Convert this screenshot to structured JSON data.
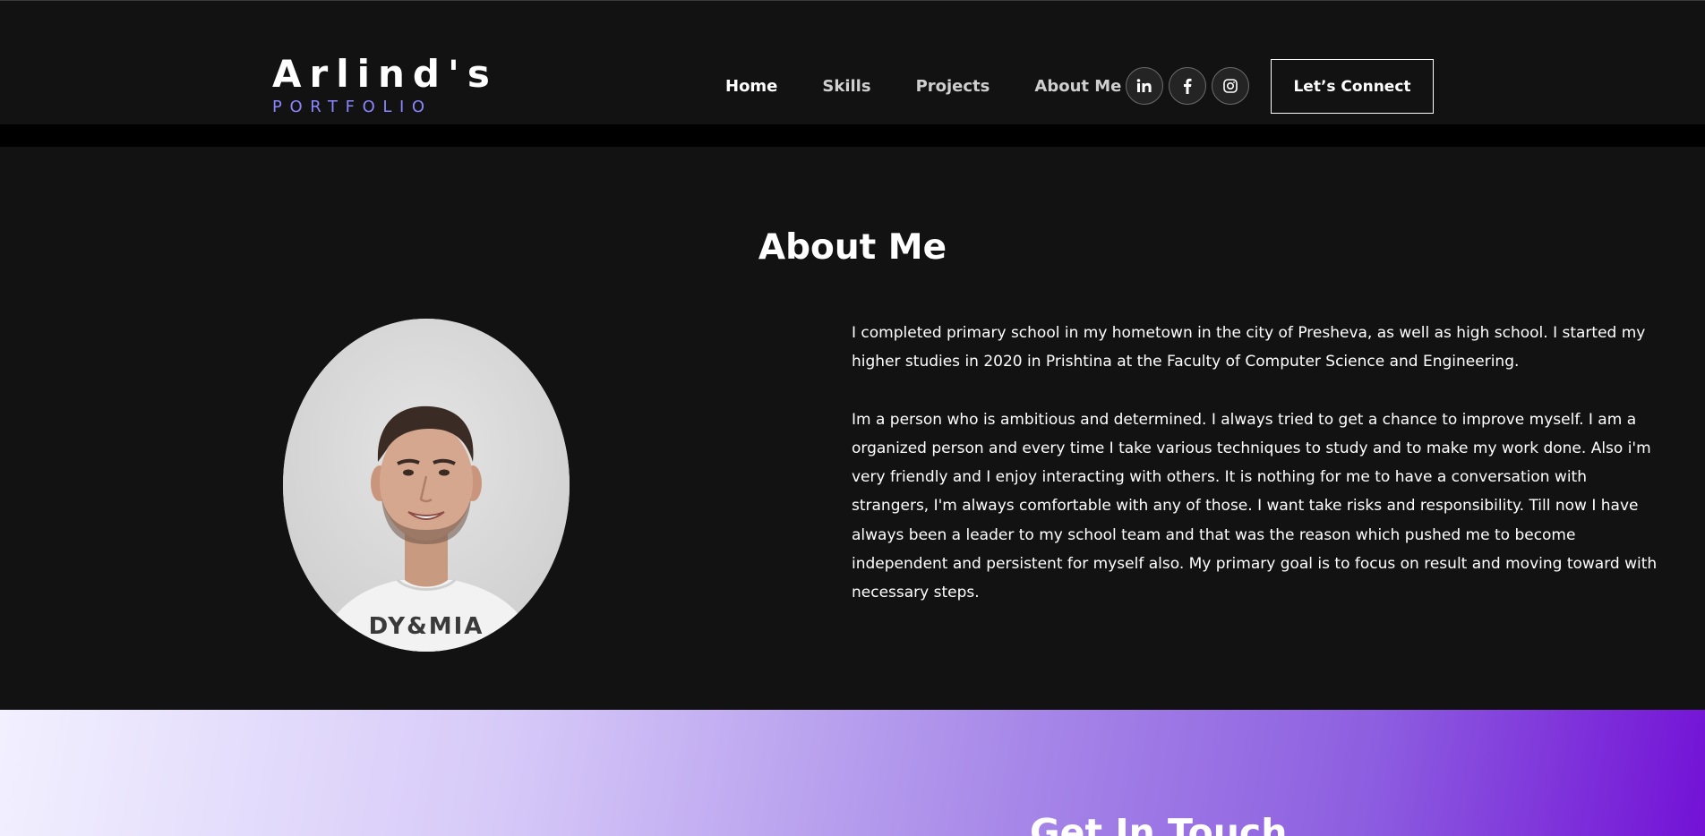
{
  "brand": {
    "title": "Arlind's",
    "subtitle": "PORTFOLIO",
    "accent_color": "#8a86ff"
  },
  "nav": {
    "items": [
      {
        "label": "Home",
        "active": true
      },
      {
        "label": "Skills",
        "active": false
      },
      {
        "label": "Projects",
        "active": false
      },
      {
        "label": "About Me",
        "active": false
      }
    ],
    "social": [
      {
        "icon": "linkedin-icon",
        "label": "in"
      },
      {
        "icon": "facebook-icon",
        "label": "f"
      },
      {
        "icon": "instagram-icon",
        "label": ""
      }
    ],
    "cta_label": "Let’s Connect"
  },
  "about": {
    "title": "About Me",
    "photo_icon": "profile-photo",
    "paragraphs": [
      "I completed primary school in my hometown in the city of Presheva, as well as high school. I started my higher studies in 2020 in Prishtina at the Faculty of Computer Science and Engineering.",
      "Im a person who is ambitious and determined. I always tried to get a chance to improve myself. I am a organized person and every time I take various techniques to study and to make my work done. Also i'm very friendly and I enjoy interacting with others. It is nothing for me to have a conversation with strangers, I'm always comfortable with any of those. I want take risks and responsibility. Till now I have always been a leader to my school team and that was the reason which pushed me to become independent and persistent for myself also. My primary goal is to focus on result and moving toward with necessary steps."
    ]
  },
  "contact": {
    "title": "Get In Touch",
    "gradient_start": "#f2f0ff",
    "gradient_end": "#7311d6"
  },
  "colors": {
    "background": "#121212",
    "text": "#ffffff",
    "nav_strip": "#000000"
  }
}
